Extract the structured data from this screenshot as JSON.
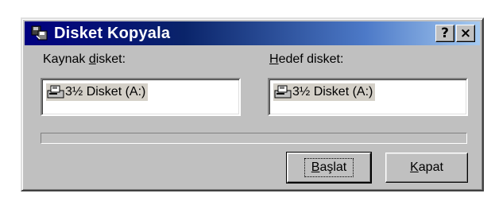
{
  "window": {
    "title": "Disket Kopyala",
    "help_button": "?",
    "close_button": "×",
    "icon": "copy-disk-icon"
  },
  "source": {
    "label_prefix": "Kaynak ",
    "label_accel": "d",
    "label_suffix": "isket:",
    "item": "3½ Disket (A:)",
    "icon": "floppy-drive-icon"
  },
  "destination": {
    "label_accel": "H",
    "label_suffix": "edef disket:",
    "item": "3½ Disket (A:)",
    "icon": "floppy-drive-icon"
  },
  "progress": {
    "value": 0
  },
  "buttons": {
    "start_accel": "B",
    "start_rest": "aşlat",
    "close_accel": "K",
    "close_rest": "apat"
  },
  "colors": {
    "titlebar_start": "#000080",
    "titlebar_end": "#a6caf0",
    "face": "#c0c0c0"
  }
}
